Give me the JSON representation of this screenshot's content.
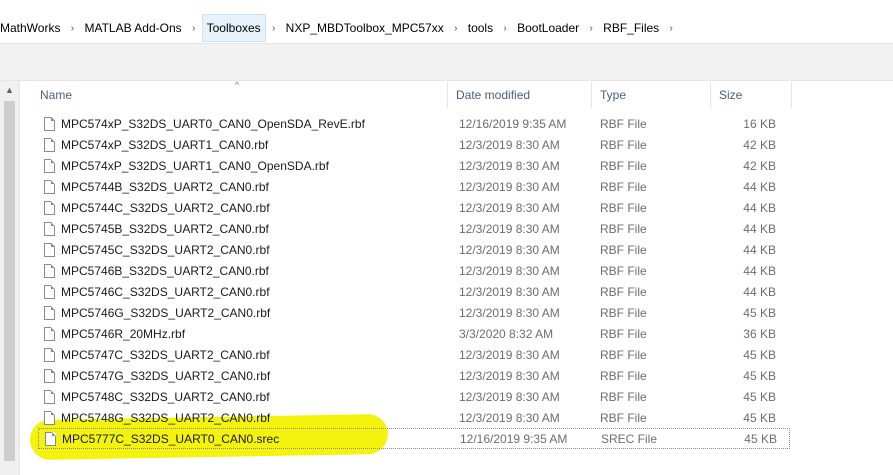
{
  "breadcrumb": [
    "MathWorks",
    "MATLAB Add-Ons",
    "Toolboxes",
    "NXP_MBDToolbox_MPC57xx",
    "tools",
    "BootLoader",
    "RBF_Files"
  ],
  "breadcrumb_active_index": 2,
  "columns": {
    "name": "Name",
    "date": "Date modified",
    "type": "Type",
    "size": "Size"
  },
  "files": [
    {
      "name": "MPC574xP_S32DS_UART0_CAN0_OpenSDA_RevE.rbf",
      "date": "12/16/2019 9:35 AM",
      "type": "RBF File",
      "size": "16 KB"
    },
    {
      "name": "MPC574xP_S32DS_UART1_CAN0.rbf",
      "date": "12/3/2019 8:30 AM",
      "type": "RBF File",
      "size": "42 KB"
    },
    {
      "name": "MPC574xP_S32DS_UART1_CAN0_OpenSDA.rbf",
      "date": "12/3/2019 8:30 AM",
      "type": "RBF File",
      "size": "42 KB"
    },
    {
      "name": "MPC5744B_S32DS_UART2_CAN0.rbf",
      "date": "12/3/2019 8:30 AM",
      "type": "RBF File",
      "size": "44 KB"
    },
    {
      "name": "MPC5744C_S32DS_UART2_CAN0.rbf",
      "date": "12/3/2019 8:30 AM",
      "type": "RBF File",
      "size": "44 KB"
    },
    {
      "name": "MPC5745B_S32DS_UART2_CAN0.rbf",
      "date": "12/3/2019 8:30 AM",
      "type": "RBF File",
      "size": "44 KB"
    },
    {
      "name": "MPC5745C_S32DS_UART2_CAN0.rbf",
      "date": "12/3/2019 8:30 AM",
      "type": "RBF File",
      "size": "44 KB"
    },
    {
      "name": "MPC5746B_S32DS_UART2_CAN0.rbf",
      "date": "12/3/2019 8:30 AM",
      "type": "RBF File",
      "size": "44 KB"
    },
    {
      "name": "MPC5746C_S32DS_UART2_CAN0.rbf",
      "date": "12/3/2019 8:30 AM",
      "type": "RBF File",
      "size": "44 KB"
    },
    {
      "name": "MPC5746G_S32DS_UART2_CAN0.rbf",
      "date": "12/3/2019 8:30 AM",
      "type": "RBF File",
      "size": "45 KB"
    },
    {
      "name": "MPC5746R_20MHz.rbf",
      "date": "3/3/2020 8:32 AM",
      "type": "RBF File",
      "size": "36 KB"
    },
    {
      "name": "MPC5747C_S32DS_UART2_CAN0.rbf",
      "date": "12/3/2019 8:30 AM",
      "type": "RBF File",
      "size": "45 KB"
    },
    {
      "name": "MPC5747G_S32DS_UART2_CAN0.rbf",
      "date": "12/3/2019 8:30 AM",
      "type": "RBF File",
      "size": "45 KB"
    },
    {
      "name": "MPC5748C_S32DS_UART2_CAN0.rbf",
      "date": "12/3/2019 8:30 AM",
      "type": "RBF File",
      "size": "45 KB"
    },
    {
      "name": "MPC5748G_S32DS_UART2_CAN0.rbf",
      "date": "12/3/2019 8:30 AM",
      "type": "RBF File",
      "size": "45 KB"
    },
    {
      "name": "MPC5777C_S32DS_UART0_CAN0.srec",
      "date": "12/16/2019 9:35 AM",
      "type": "SREC File",
      "size": "45 KB"
    }
  ],
  "selected_file_index": 15,
  "icons": {
    "breadcrumb_separator": "chevron-right-icon",
    "sort": "sort-ascending-icon",
    "file": "document-icon",
    "scroll_up": "scroll-up-arrow-icon"
  },
  "colors": {
    "highlight": "#f2f200",
    "active_crumb_bg": "#e5f1fb",
    "header_text": "#4c607a"
  }
}
